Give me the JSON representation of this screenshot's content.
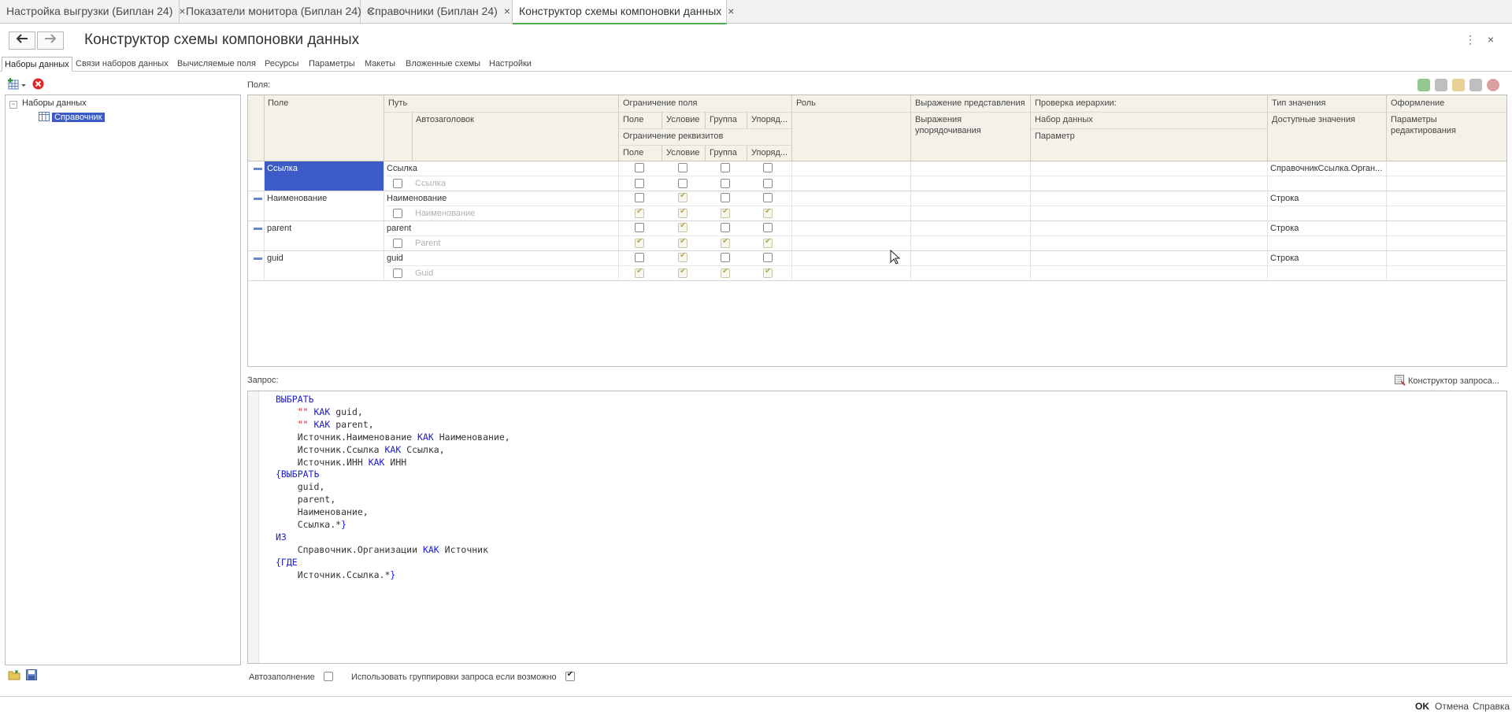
{
  "tabs": [
    {
      "label": "Настройка выгрузки (Биплан 24)",
      "close": "×"
    },
    {
      "label": "Показатели монитора (Биплан 24)",
      "close": "×"
    },
    {
      "label": "Справочники (Биплан 24)",
      "close": "×"
    },
    {
      "label": "Конструктор схемы компоновки данных",
      "close": "×",
      "active": true
    }
  ],
  "header": {
    "back_icon": "arrow-left-icon",
    "forward_icon": "arrow-right-icon",
    "title": "Конструктор схемы компоновки данных",
    "more_icon": "⋮",
    "close_icon": "×"
  },
  "subtabs": [
    "Наборы данных",
    "Связи наборов данных",
    "Вычисляемые поля",
    "Ресурсы",
    "Параметры",
    "Макеты",
    "Вложенные схемы",
    "Настройки"
  ],
  "tree": {
    "root": "Наборы данных",
    "child": "Справочник"
  },
  "fields_label": "Поля:",
  "grid": {
    "headers": {
      "field": "Поле",
      "path": "Путь",
      "autotitle": "Автозаголовок",
      "restriction": "Ограничение поля",
      "r_field": "Поле",
      "r_condition": "Условие",
      "r_group": "Группа",
      "r_order": "Упоряд...",
      "attr_restriction": "Ограничение реквизитов",
      "a_field": "Поле",
      "a_condition": "Условие",
      "a_group": "Группа",
      "a_order": "Упоряд...",
      "role": "Роль",
      "presentation": "Выражение представления",
      "ordering": "Выражения упорядочивания",
      "hierarchy": "Проверка иерархии:",
      "dataset": "Набор данных",
      "parameter": "Параметр",
      "value_type": "Тип значения",
      "available_values": "Доступные значения",
      "appearance": "Оформление",
      "edit_params": "Параметры редактирования"
    },
    "rows": [
      {
        "field": "Ссылка",
        "path": "Ссылка",
        "title": "Ссылка",
        "type": "СправочникСсылка.Орган...",
        "selected": true,
        "r": [
          false,
          false,
          false,
          false
        ],
        "a": [
          false,
          false,
          false,
          false
        ]
      },
      {
        "field": "Наименование",
        "path": "Наименование",
        "title": "Наименование",
        "type": "Строка",
        "r": [
          false,
          true,
          false,
          false
        ],
        "a": [
          true,
          true,
          true,
          true
        ]
      },
      {
        "field": "parent",
        "path": "parent",
        "title": "Parent",
        "type": "Строка",
        "r": [
          false,
          true,
          false,
          false
        ],
        "a": [
          true,
          true,
          true,
          true
        ]
      },
      {
        "field": "guid",
        "path": "guid",
        "title": "Guid",
        "type": "Строка",
        "r": [
          false,
          true,
          false,
          false
        ],
        "a": [
          true,
          true,
          true,
          true
        ]
      }
    ]
  },
  "query_label": "Запрос:",
  "query_constructor": "Конструктор запроса...",
  "autofill_label": "Автозаполнение",
  "autofill_checked": false,
  "use_groupings_label": "Использовать группировки запроса если возможно",
  "use_groupings_checked": true,
  "footer": {
    "ok": "OK",
    "cancel": "Отмена",
    "help": "Справка"
  },
  "colors": {
    "selection": "#3d5bc7",
    "keyword": "#1a1ad6",
    "string": "#d01010",
    "active_tab": "#4caf50"
  }
}
